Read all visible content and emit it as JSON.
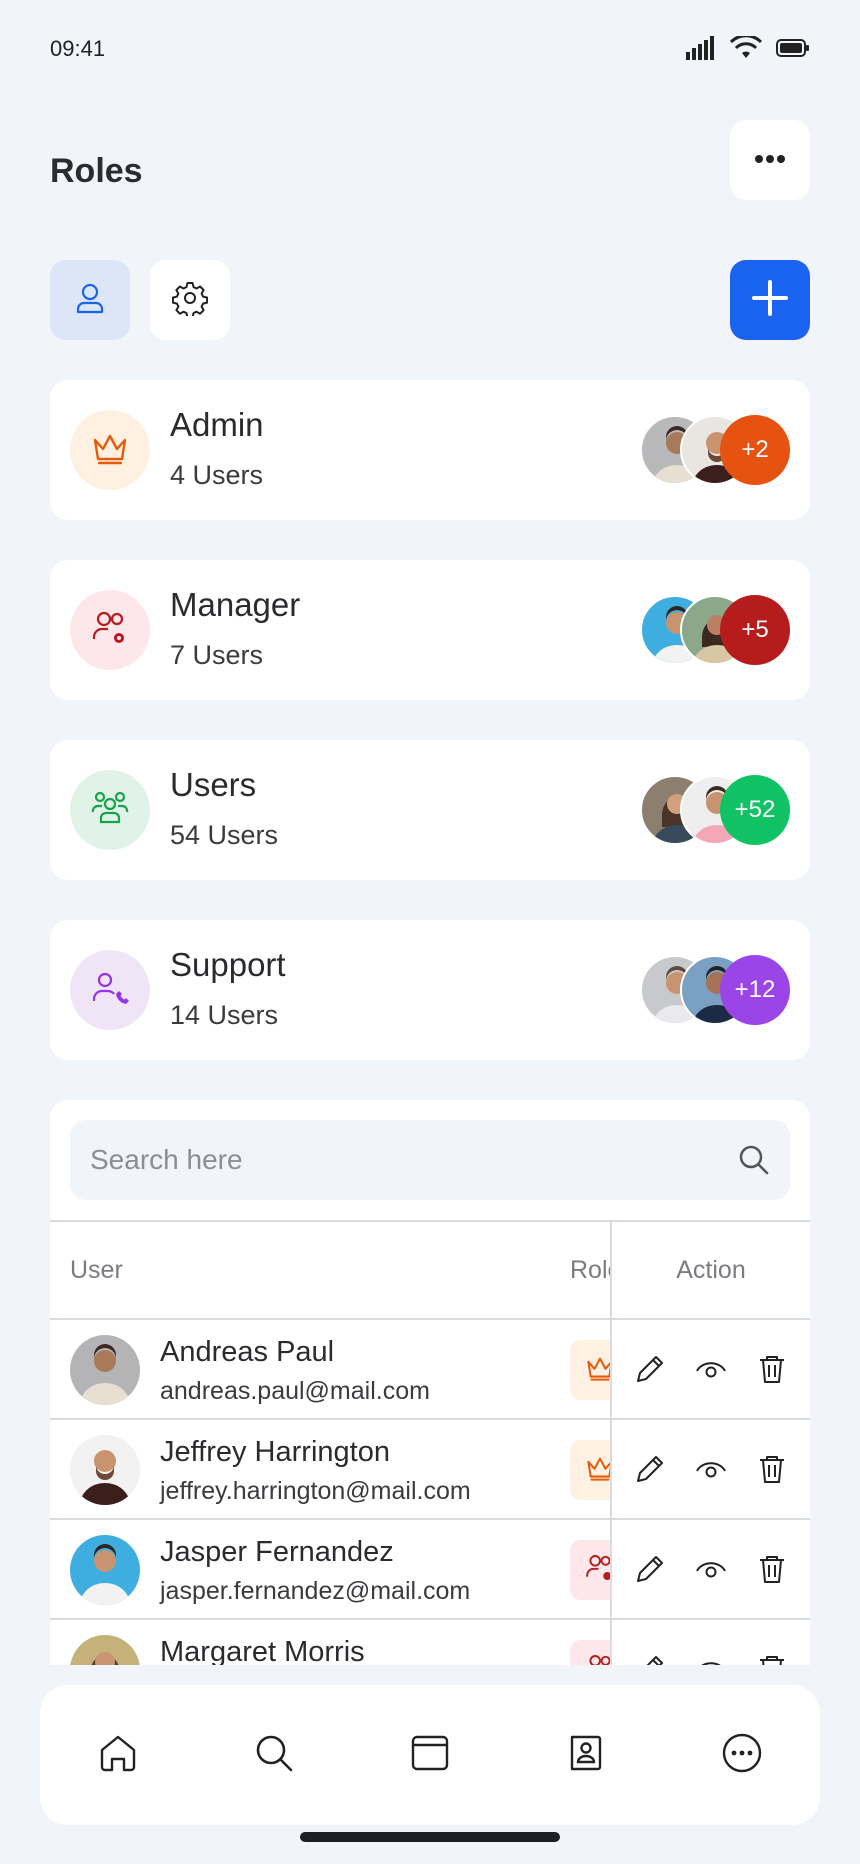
{
  "status_bar": {
    "time": "09:41"
  },
  "header": {
    "title": "Roles"
  },
  "roles": [
    {
      "name": "Admin",
      "count": "4 Users",
      "more": "+2",
      "icon": "crown-icon",
      "icon_color": "#e65b0b",
      "icon_bg": "#fff1e1",
      "accent": "#e6520f"
    },
    {
      "name": "Manager",
      "count": "7 Users",
      "more": "+5",
      "icon": "users-gear-icon",
      "icon_color": "#b71c1c",
      "icon_bg": "#fde7ea",
      "accent": "#b71c1c"
    },
    {
      "name": "Users",
      "count": "54 Users",
      "more": "+52",
      "icon": "user-group-icon",
      "icon_color": "#16a34a",
      "icon_bg": "#e1f3e9",
      "accent": "#10c264"
    },
    {
      "name": "Support",
      "count": "14 Users",
      "more": "+12",
      "icon": "user-phone-icon",
      "icon_color": "#9333ea",
      "icon_bg": "#efe5f6",
      "accent": "#9b45e8"
    }
  ],
  "search": {
    "placeholder": "Search here"
  },
  "table": {
    "columns": {
      "user": "User",
      "role": "Role",
      "action": "Action"
    },
    "rows": [
      {
        "name": "Andreas Paul",
        "email": "andreas.paul@mail.com",
        "role_icon": "crown-icon",
        "role_color": "#e65b0b",
        "role_bg": "#fff1e1"
      },
      {
        "name": "Jeffrey Harrington",
        "email": "jeffrey.harrington@mail.com",
        "role_icon": "crown-icon",
        "role_color": "#e65b0b",
        "role_bg": "#fff1e1"
      },
      {
        "name": "Jasper Fernandez",
        "email": "jasper.fernandez@mail.com",
        "role_icon": "users-gear-icon",
        "role_color": "#b71c1c",
        "role_bg": "#fde7ea"
      },
      {
        "name": "Margaret Morris",
        "email": "",
        "role_icon": "users-gear-icon",
        "role_color": "#b71c1c",
        "role_bg": "#fde7ea"
      }
    ]
  },
  "colors": {
    "accent": "#1a63f0",
    "background": "#f1f4f9"
  }
}
